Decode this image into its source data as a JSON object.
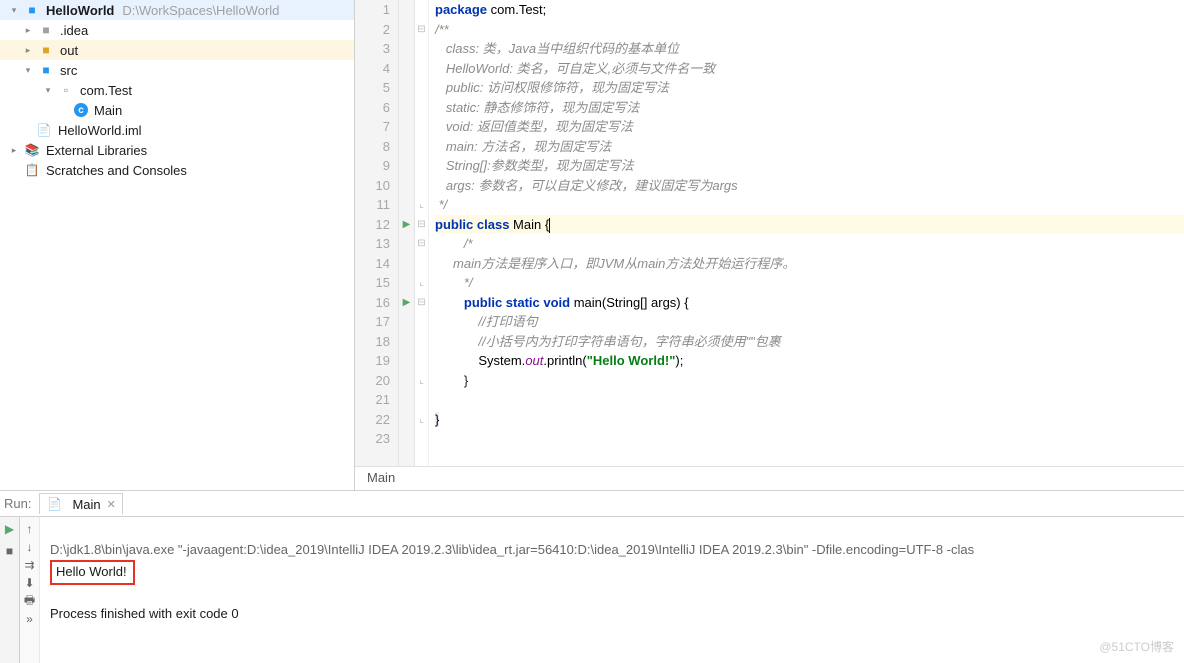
{
  "project": {
    "name": "HelloWorld",
    "path": "D:\\WorkSpaces\\HelloWorld",
    "tree": {
      "idea": ".idea",
      "out": "out",
      "src": "src",
      "pkg": "com.Test",
      "mainClass": "Main",
      "iml": "HelloWorld.iml",
      "extLib": "External Libraries",
      "scratch": "Scratches and Consoles"
    }
  },
  "code": [
    {
      "n": 1,
      "t": "package ",
      "k": true,
      "r": "com.Test;"
    },
    {
      "n": 2,
      "c": "/**"
    },
    {
      "n": 3,
      "c": "   class: 类，Java当中组织代码的基本单位"
    },
    {
      "n": 4,
      "c": "   HelloWorld: 类名，可自定义,必须与文件名一致"
    },
    {
      "n": 5,
      "c": "   public: 访问权限修饰符，现为固定写法"
    },
    {
      "n": 6,
      "c": "   static: 静态修饰符，现为固定写法"
    },
    {
      "n": 7,
      "c": "   void: 返回值类型，现为固定写法"
    },
    {
      "n": 8,
      "c": "   main: 方法名，现为固定写法"
    },
    {
      "n": 9,
      "c": "   String[]:参数类型，现为固定写法"
    },
    {
      "n": 10,
      "c": "   args: 参数名，可以自定义修改，建议固定写为args"
    },
    {
      "n": 11,
      "c": " */"
    },
    {
      "n": 12,
      "run": true,
      "hl": true,
      "raw": "public class Main {",
      "caret": true
    },
    {
      "n": 13,
      "c": "        /*"
    },
    {
      "n": 14,
      "c": "     main方法是程序入口，即JVM从main方法处开始运行程序。"
    },
    {
      "n": 15,
      "c": "        */"
    },
    {
      "n": 16,
      "run": true,
      "raw": "        public static void main(String[] args) {"
    },
    {
      "n": 17,
      "c": "            //打印语句"
    },
    {
      "n": 18,
      "c": "            //小括号内为打印字符串语句，字符串必须使用\"\"包裹"
    },
    {
      "n": 19,
      "raw": "            System.out.println(\"Hello World!\");",
      "print": true
    },
    {
      "n": 20,
      "raw": "        }"
    },
    {
      "n": 21,
      "raw": ""
    },
    {
      "n": 22,
      "raw": "}",
      "closeHl": true
    },
    {
      "n": 23,
      "raw": ""
    }
  ],
  "breadcrumb": "Main",
  "runTool": {
    "title": "Run:",
    "tab": "Main",
    "cmdLine": "D:\\jdk1.8\\bin\\java.exe \"-javaagent:D:\\idea_2019\\IntelliJ IDEA 2019.2.3\\lib\\idea_rt.jar=56410:D:\\idea_2019\\IntelliJ IDEA 2019.2.3\\bin\" -Dfile.encoding=UTF-8 -clas",
    "hello": "Hello World!",
    "exit": "Process finished with exit code 0"
  },
  "watermark": "@51CTO博客"
}
